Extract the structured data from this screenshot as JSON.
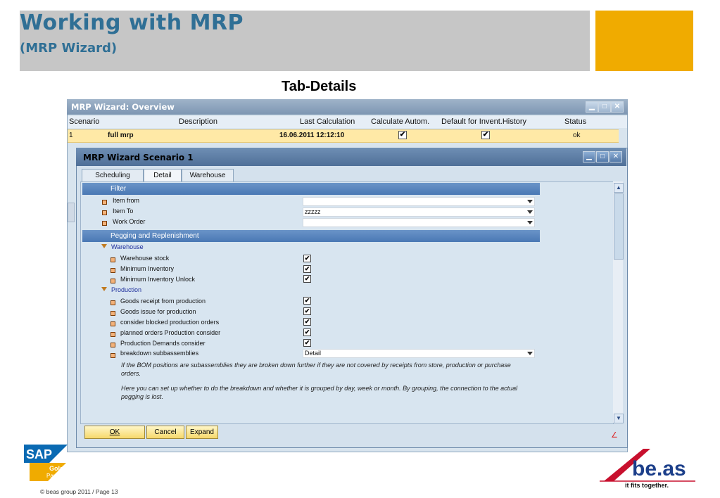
{
  "slide": {
    "title": "Working with MRP",
    "subtitle": "(MRP Wizard)",
    "section_heading": "Tab-Details",
    "footer": "© beas group 2011 / Page 13"
  },
  "overview": {
    "title": "MRP Wizard: Overview",
    "columns": [
      "Scenario",
      "Description",
      "Last Calculation",
      "Calculate Autom.",
      "Default for Invent.History",
      "Status"
    ],
    "row": {
      "num": "1",
      "scenario": "full mrp",
      "last_calc": "16.06.2011 12:12:10",
      "calc_auto": "✔",
      "default_inv": "✔",
      "status": "ok"
    }
  },
  "scenario_window": {
    "title": "MRP Wizard Scenario 1",
    "tabs": [
      "Scheduling",
      "Detail",
      "Warehouse"
    ],
    "filter": {
      "header": "Filter",
      "item_from": "Item from",
      "item_to": "Item To",
      "item_to_value": "zzzzz",
      "work_order": "Work Order"
    },
    "pegging": {
      "header": "Pegging and Replenishment",
      "warehouse_group": "Warehouse",
      "warehouse_stock": "Warehouse stock",
      "min_inventory": "Minimum Inventory",
      "min_inventory_unlock": "Minimum Inventory Unlock",
      "production_group": "Production",
      "goods_receipt": "Goods receipt from production",
      "goods_issue": "Goods issue for production",
      "consider_blocked": "consider blocked production orders",
      "planned_orders": "planned orders Production consider",
      "prod_demands": "Production Demands consider",
      "breakdown": "breakdown subbassemblies",
      "breakdown_value": "Detail",
      "check": "✔"
    },
    "note1_line1": "If the BOM positions are subassemblies they are broken down further if they are not covered by receipts from store, production or purchase",
    "note1_line2": "orders.",
    "note2_line1": "Here you can set up whether to do the breakdown and whether it is grouped by day, week or month. By grouping, the connection to the actual",
    "note2_line2": "pegging is lost.",
    "buttons": {
      "ok": "OK",
      "cancel": "Cancel",
      "expand": "Expand"
    }
  },
  "logos": {
    "sap": "SAP",
    "sap_gold": "Gold",
    "sap_partner": "Partner",
    "beas": "be.as",
    "beas_tagline": "it fits together."
  },
  "colors": {
    "title_blue": "#2f6f95",
    "accent_orange": "#f0ab00",
    "section_blue": "#4a78b4",
    "row_highlight": "#ffe9a6"
  }
}
